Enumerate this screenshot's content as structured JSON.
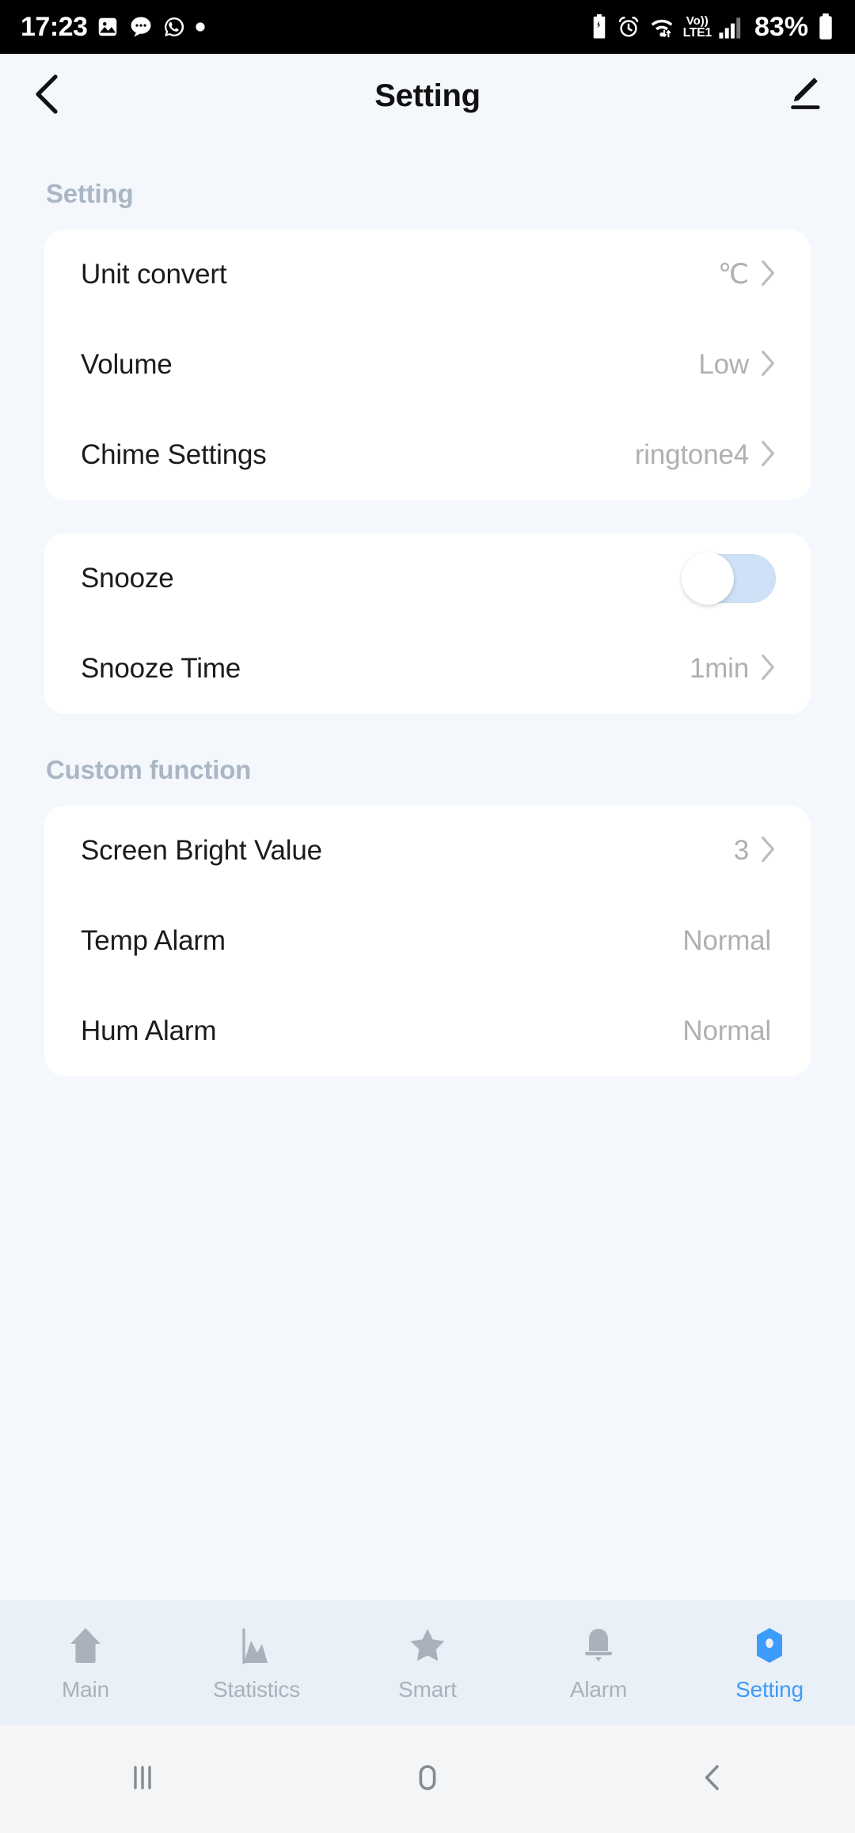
{
  "status_bar": {
    "time": "17:23",
    "left_icons": [
      "gallery-icon",
      "messages-icon",
      "whatsapp-icon",
      "dot-icon"
    ],
    "right_icons": [
      "battery-saver-icon",
      "alarm-icon",
      "wifi-icon"
    ],
    "network_line1": "Vo))",
    "network_line2": "LTE1",
    "battery_percent": "83%"
  },
  "header": {
    "back_icon": "chevron-left-icon",
    "title": "Setting",
    "edit_icon": "pencil-icon"
  },
  "sections": [
    {
      "label": "Setting",
      "rows": [
        {
          "label": "Unit convert",
          "value": "℃",
          "chevron": true,
          "type": "nav"
        },
        {
          "label": "Volume",
          "value": "Low",
          "chevron": true,
          "type": "nav"
        },
        {
          "label": "Chime Settings",
          "value": "ringtone4",
          "chevron": true,
          "type": "nav"
        }
      ]
    },
    {
      "label": "",
      "rows": [
        {
          "label": "Snooze",
          "value": "",
          "chevron": false,
          "type": "toggle",
          "toggle_on": false
        },
        {
          "label": "Snooze Time",
          "value": "1min",
          "chevron": true,
          "type": "nav"
        }
      ]
    },
    {
      "label": "Custom function",
      "rows": [
        {
          "label": "Screen Bright Value",
          "value": "3",
          "chevron": true,
          "type": "nav"
        },
        {
          "label": "Temp Alarm",
          "value": "Normal",
          "chevron": false,
          "type": "value"
        },
        {
          "label": "Hum Alarm",
          "value": "Normal",
          "chevron": false,
          "type": "value"
        }
      ]
    }
  ],
  "tabbar": {
    "items": [
      {
        "label": "Main",
        "icon": "home-icon",
        "active": false
      },
      {
        "label": "Statistics",
        "icon": "chart-icon",
        "active": false
      },
      {
        "label": "Smart",
        "icon": "star-icon",
        "active": false
      },
      {
        "label": "Alarm",
        "icon": "bell-icon",
        "active": false
      },
      {
        "label": "Setting",
        "icon": "hexagon-gear-icon",
        "active": true
      }
    ],
    "active_color": "#3d9bfb",
    "inactive_color": "#a9b2bb"
  },
  "navbar": {
    "recents_icon": "recents-icon",
    "home_icon": "home-squircle-icon",
    "back_icon": "back-chevron-icon"
  }
}
